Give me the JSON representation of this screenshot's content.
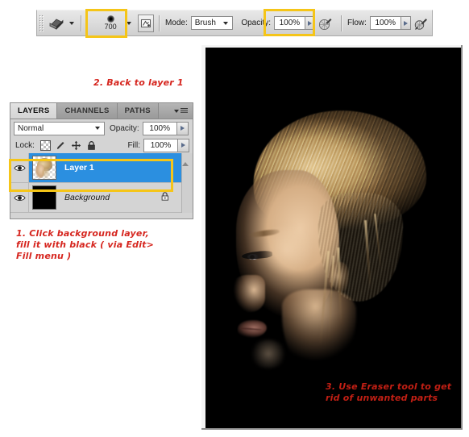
{
  "options_bar": {
    "tool_icon": "eraser-icon",
    "tool_dropdown_icon": "chevron-down-icon",
    "brush_preset": {
      "size_label": "700",
      "preview_icon": "soft-round-brush-icon",
      "dropdown_icon": "chevron-down-icon",
      "highlighted": true
    },
    "toggle_brush_panel_icon": "toggle-brushes-panel-icon",
    "mode_label": "Mode:",
    "mode_value": "Brush",
    "mode_dropdown_icon": "chevron-down-icon",
    "opacity_label": "Opacity:",
    "opacity_value": "100%",
    "opacity_spin_icon": "spinner-arrow-icon",
    "opacity_highlighted": true,
    "airbrush_icon": "airbrush-icon",
    "flow_label": "Flow:",
    "flow_value": "100%",
    "flow_spin_icon": "spinner-arrow-icon",
    "pressure_icon": "tablet-pressure-icon"
  },
  "layers_panel": {
    "tabs": [
      {
        "label": "LAYERS",
        "active": true
      },
      {
        "label": "CHANNELS",
        "active": false
      },
      {
        "label": "PATHS",
        "active": false
      }
    ],
    "menu_icon": "panel-menu-icon",
    "blend_mode": "Normal",
    "blend_mode_dropdown_icon": "chevron-down-icon",
    "opacity_label": "Opacity:",
    "opacity_value": "100%",
    "lock_label": "Lock:",
    "lock_icons": [
      "lock-transparent-pixels-icon",
      "lock-image-pixels-icon",
      "lock-position-icon",
      "lock-all-icon"
    ],
    "fill_label": "Fill:",
    "fill_value": "100%",
    "layers": [
      {
        "name": "Layer 1",
        "visible": true,
        "selected": true,
        "thumb": "portrait-thumbnail",
        "locked": false
      },
      {
        "name": "Background",
        "visible": true,
        "selected": false,
        "thumb": "black-thumbnail",
        "locked": true,
        "lock_icon": "padlock-icon"
      }
    ],
    "eye_icon": "eye-visibility-icon",
    "scrollbar_up_icon": "scroll-up-arrow-icon"
  },
  "canvas": {
    "image_description": "portrait-of-blonde-woman-in-profile-on-black-background",
    "background_color": "#000000"
  },
  "annotations": [
    {
      "id": "annotation-1",
      "text": "1. Click background layer,\nfill it with black ( via Edit>\nFill menu )"
    },
    {
      "id": "annotation-2",
      "text": "2. Back to layer 1"
    },
    {
      "id": "annotation-3",
      "text": "3. Use Eraser tool to get\nrid of unwanted parts"
    }
  ],
  "colors": {
    "highlight": "#f5c518",
    "annotation_red": "#d6261f",
    "selection_blue": "#2b8fe0",
    "panel_gray": "#d4d4d4"
  }
}
